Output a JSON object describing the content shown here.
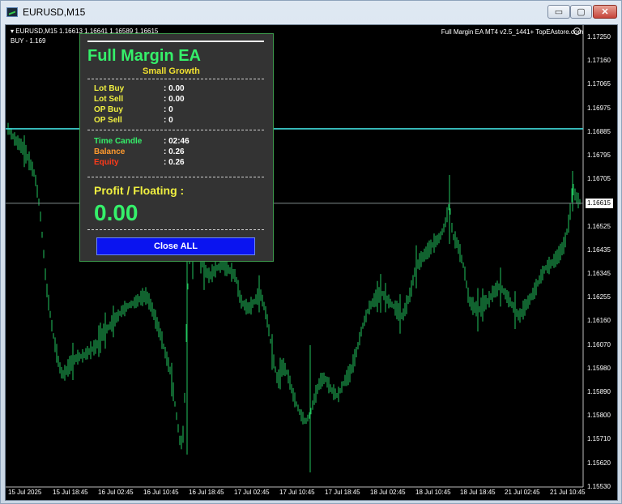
{
  "window": {
    "title": "EURUSD,M15",
    "minimize": "▭",
    "maximize": "▢",
    "close": "✕"
  },
  "chart": {
    "symbol_line": "▾ EURUSD,M15  1.16613 1.16641 1.16589 1.16615",
    "position_line": "BUY - 1.169",
    "ea_name": "Full Margin EA MT4 v2.5_1441+ TopEAstore.com",
    "current_price": "1.16615",
    "price_levels": [
      "1.17250",
      "1.17160",
      "1.17065",
      "1.16975",
      "1.16885",
      "1.16795",
      "1.16705",
      "1.16615",
      "1.16525",
      "1.16435",
      "1.16345",
      "1.16255",
      "1.16160",
      "1.16070",
      "1.15980",
      "1.15890",
      "1.15800",
      "1.15710",
      "1.15620",
      "1.15530"
    ],
    "time_labels": [
      "15 Jul 2025",
      "15 Jul 18:45",
      "16 Jul 02:45",
      "16 Jul 10:45",
      "16 Jul 18:45",
      "17 Jul 02:45",
      "17 Jul 10:45",
      "17 Jul 18:45",
      "18 Jul 02:45",
      "18 Jul 10:45",
      "18 Jul 18:45",
      "21 Jul 02:45",
      "21 Jul 10:45"
    ],
    "buy_line_price": 1.169,
    "candle_color": "#22c55e",
    "line_color": "#3fd8d8"
  },
  "panel": {
    "title": "Full Margin EA",
    "subtitle": "Small Growth",
    "rows": [
      {
        "label": "Lot Buy",
        "value": ": 0.00"
      },
      {
        "label": "Lot Sell",
        "value": ": 0.00"
      },
      {
        "label": "OP Buy",
        "value": ": 0"
      },
      {
        "label": "OP Sell",
        "value": ": 0"
      }
    ],
    "rows2": [
      {
        "label": "Time Candle",
        "value": ": 02:46"
      },
      {
        "label": "Balance",
        "value": ": 0.26"
      },
      {
        "label": "Equity",
        "value": ": 0.26"
      }
    ],
    "profit_label": "Profit / Floating  :",
    "profit_value": "0.00",
    "close_all": "Close ALL"
  }
}
